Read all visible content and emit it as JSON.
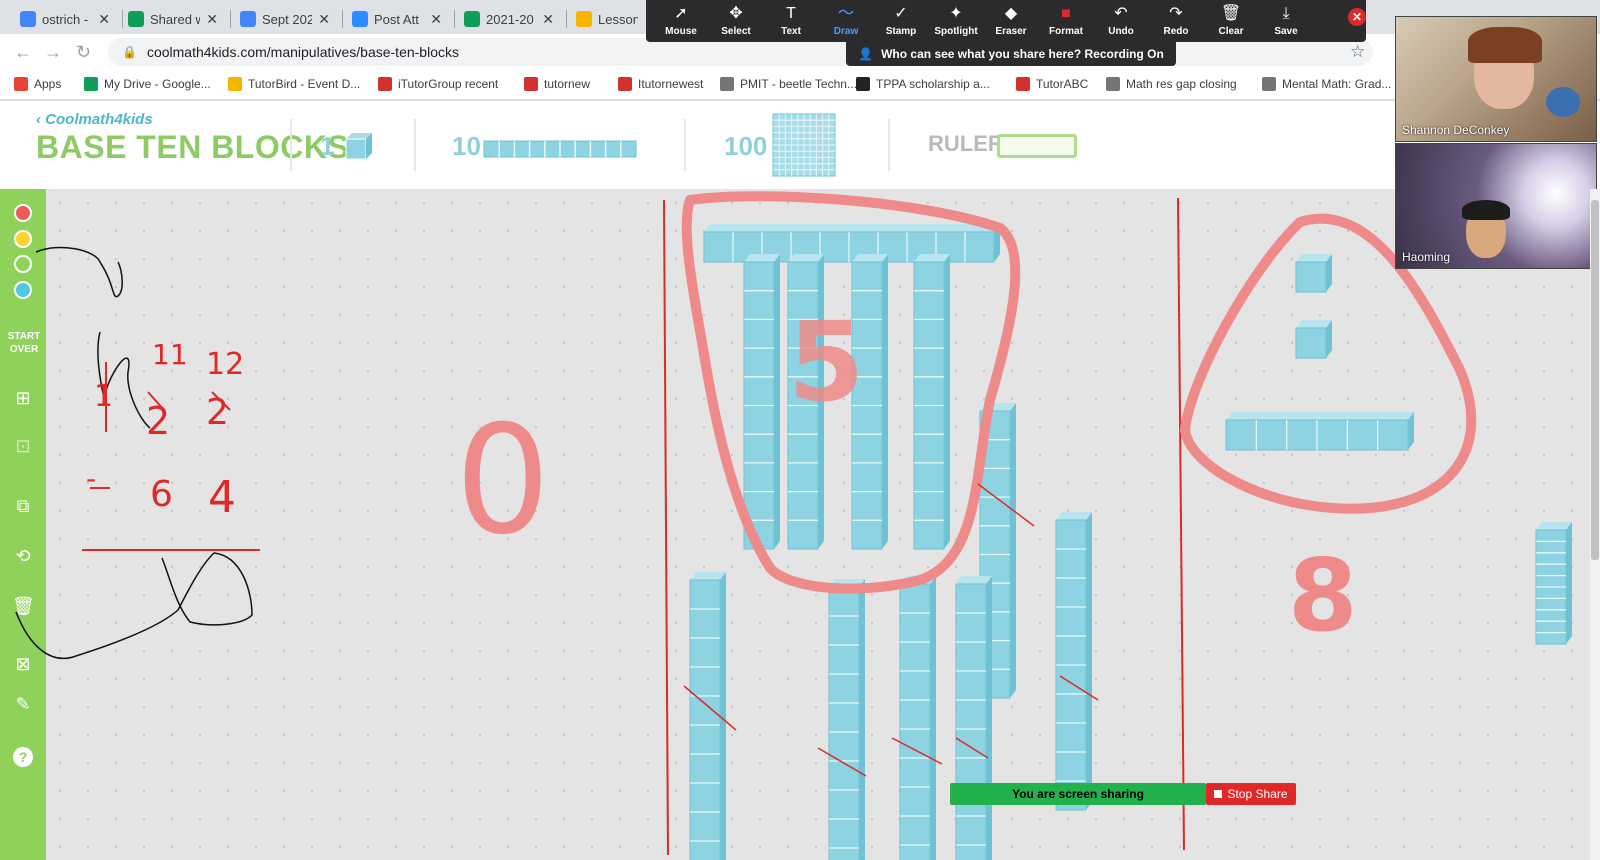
{
  "tabs": [
    {
      "title": "ostrich -",
      "icon": "google-icon",
      "color": "#4285f4"
    },
    {
      "title": "Shared w",
      "icon": "google-drive-icon",
      "color": "#0f9d58"
    },
    {
      "title": "Sept 202",
      "icon": "google-docs-icon",
      "color": "#4285f4"
    },
    {
      "title": "Post Att",
      "icon": "zoom-icon",
      "color": "#2d8cff"
    },
    {
      "title": "2021-20",
      "icon": "google-sheets-icon",
      "color": "#0f9d58"
    },
    {
      "title": "Lessons",
      "icon": "classroom-icon",
      "color": "#f4b400"
    }
  ],
  "address_bar": {
    "url": "coolmath4kids.com/manipulatives/base-ten-blocks"
  },
  "bookmarks": [
    {
      "label": "Apps",
      "icon": "apps-grid-icon",
      "color": "#ea4335"
    },
    {
      "label": "My Drive - Google...",
      "icon": "google-drive-icon",
      "color": "#0f9d58"
    },
    {
      "label": "TutorBird - Event D...",
      "icon": "tutorbird-icon",
      "color": "#f4b400"
    },
    {
      "label": "iTutorGroup recent",
      "icon": "itutor-icon",
      "color": "#d32f2f"
    },
    {
      "label": "tutornew",
      "icon": "itutor-icon",
      "color": "#d32f2f"
    },
    {
      "label": "Itutornewest",
      "icon": "itutor-icon",
      "color": "#d32f2f"
    },
    {
      "label": "PMIT - beetle Techn...",
      "icon": "globe-icon",
      "color": "#757575"
    },
    {
      "label": "TPPA scholarship a...",
      "icon": "tppa-icon",
      "color": "#222222"
    },
    {
      "label": "TutorABC",
      "icon": "itutor-icon",
      "color": "#d32f2f"
    },
    {
      "label": "Math res gap closing",
      "icon": "globe-icon",
      "color": "#757575"
    },
    {
      "label": "Mental Math: Grad...",
      "icon": "globe-icon",
      "color": "#757575"
    }
  ],
  "zoom_toolbar": {
    "tools": [
      {
        "label": "Mouse",
        "icon": "cursor-icon",
        "glyph": "➚"
      },
      {
        "label": "Select",
        "icon": "move-icon",
        "glyph": "✥"
      },
      {
        "label": "Text",
        "icon": "text-icon",
        "glyph": "T"
      },
      {
        "label": "Draw",
        "icon": "draw-icon",
        "glyph": "〜"
      },
      {
        "label": "Stamp",
        "icon": "checkmark-icon",
        "glyph": "✓"
      },
      {
        "label": "Spotlight",
        "icon": "spotlight-icon",
        "glyph": "✦"
      },
      {
        "label": "Eraser",
        "icon": "eraser-icon",
        "glyph": "◆"
      },
      {
        "label": "Format",
        "icon": "format-icon",
        "glyph": "■"
      },
      {
        "label": "Undo",
        "icon": "undo-icon",
        "glyph": "↶"
      },
      {
        "label": "Redo",
        "icon": "redo-icon",
        "glyph": "↷"
      },
      {
        "label": "Clear",
        "icon": "trash-icon",
        "glyph": "🗑"
      },
      {
        "label": "Save",
        "icon": "download-icon",
        "glyph": "⤓"
      }
    ],
    "active": "Draw",
    "recording_notice": "Who can see what you share here? Recording On"
  },
  "app": {
    "brand": "Coolmath4kids",
    "title": "BASE TEN BLOCKS",
    "block_labels": [
      "1",
      "10",
      "100"
    ],
    "ruler_label": "RULER",
    "start_over": "START OVER",
    "pen_colors": [
      "#ee5a5a",
      "#f8d42c",
      "#8ed15b",
      "#4fc9e0"
    ]
  },
  "annotations": {
    "top_borrow_left": "11",
    "top_borrow_right": "12",
    "digit_left": "2",
    "digit_right": "2",
    "crossed_digit": "1",
    "subtrahend_tens": "6",
    "subtrahend_ones": "4",
    "minus_sign": "-",
    "circle_label_middle": "5",
    "label_right_group": "8",
    "label_left_group": "0"
  },
  "participants": [
    {
      "name": "Shannon DeConkey"
    },
    {
      "name": "Haoming"
    }
  ],
  "share_bar": {
    "status": "You are screen sharing",
    "stop_label": "Stop Share"
  }
}
